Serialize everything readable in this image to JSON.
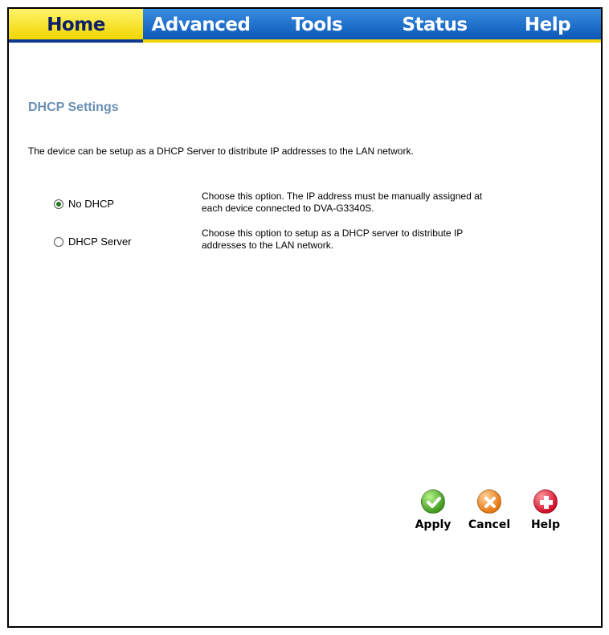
{
  "tabs": {
    "home": "Home",
    "advanced": "Advanced",
    "tools": "Tools",
    "status": "Status",
    "help": "Help"
  },
  "page": {
    "title": "DHCP Settings",
    "description": "The device can be setup as a DHCP Server to distribute IP addresses to the LAN network."
  },
  "options": [
    {
      "label": "No DHCP",
      "selected": true,
      "description_line1": "Choose this option. The IP address must be manually assigned at",
      "description_line2": "each device connected to DVA-G3340S."
    },
    {
      "label": "DHCP Server",
      "selected": false,
      "description_line1": "Choose this option to setup as a DHCP server to distribute IP",
      "description_line2": "addresses to the LAN network."
    }
  ],
  "actions": {
    "apply": "Apply",
    "cancel": "Cancel",
    "help": "Help"
  },
  "colors": {
    "tab_active": "#f2d500",
    "tab_inactive": "#0b57b8",
    "title": "#6b8fb5",
    "apply_icon": "#3f9a1f",
    "cancel_icon": "#e87811",
    "help_icon": "#d1102a"
  },
  "icons": {
    "apply": "checkmark-icon",
    "cancel": "x-mark-icon",
    "help": "plus-icon"
  }
}
